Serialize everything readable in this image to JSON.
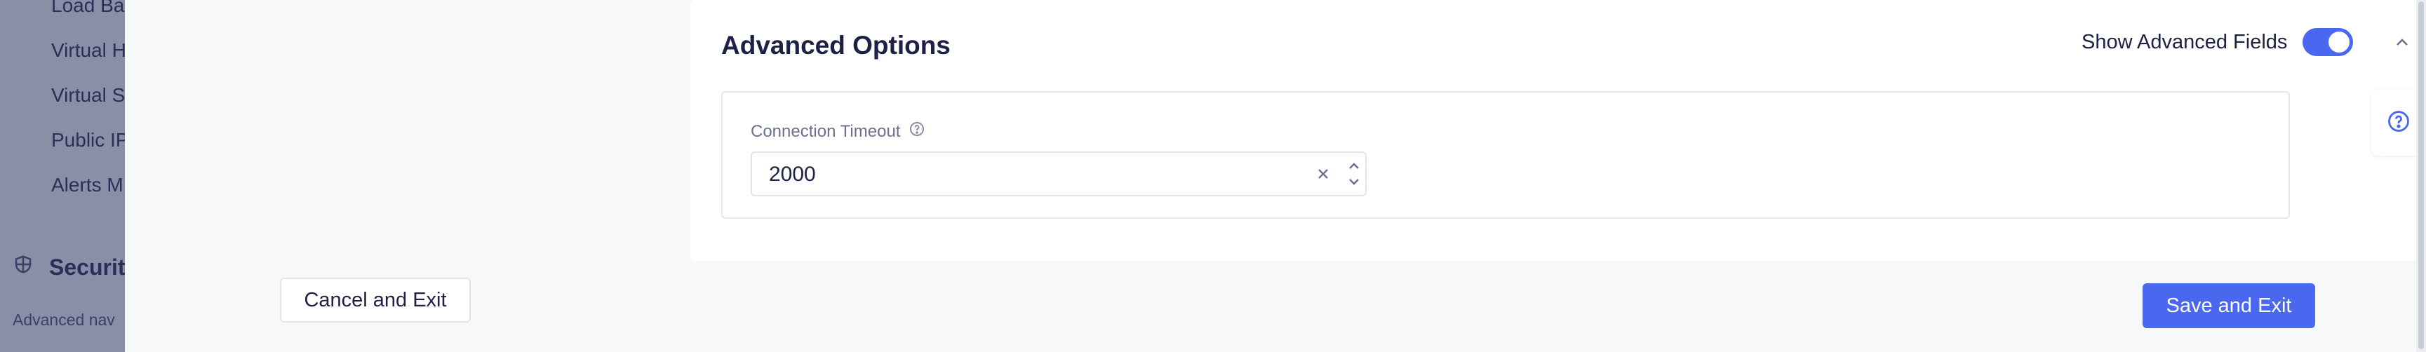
{
  "background_nav": {
    "items": [
      {
        "label": "Load Ba"
      },
      {
        "label": "Virtual H"
      },
      {
        "label": "Virtual S"
      },
      {
        "label": "Public IP"
      },
      {
        "label": "Alerts M"
      }
    ],
    "section_title": "Securit",
    "section_desc": "Advanced nav"
  },
  "advanced_options": {
    "title": "Advanced Options",
    "toggle_label": "Show Advanced Fields",
    "toggle_on": true
  },
  "connection_timeout": {
    "label": "Connection Timeout",
    "value": "2000"
  },
  "footer": {
    "cancel_label": "Cancel and Exit",
    "save_label": "Save and Exit"
  },
  "colors": {
    "accent": "#4a67f0",
    "text": "#1c2145"
  },
  "icons": {
    "shield": "shield-icon",
    "help": "help-circle-icon",
    "chevron_up": "chevron-up-icon",
    "clear": "close-icon",
    "stepper": "stepper-icon",
    "info": "info-icon"
  }
}
